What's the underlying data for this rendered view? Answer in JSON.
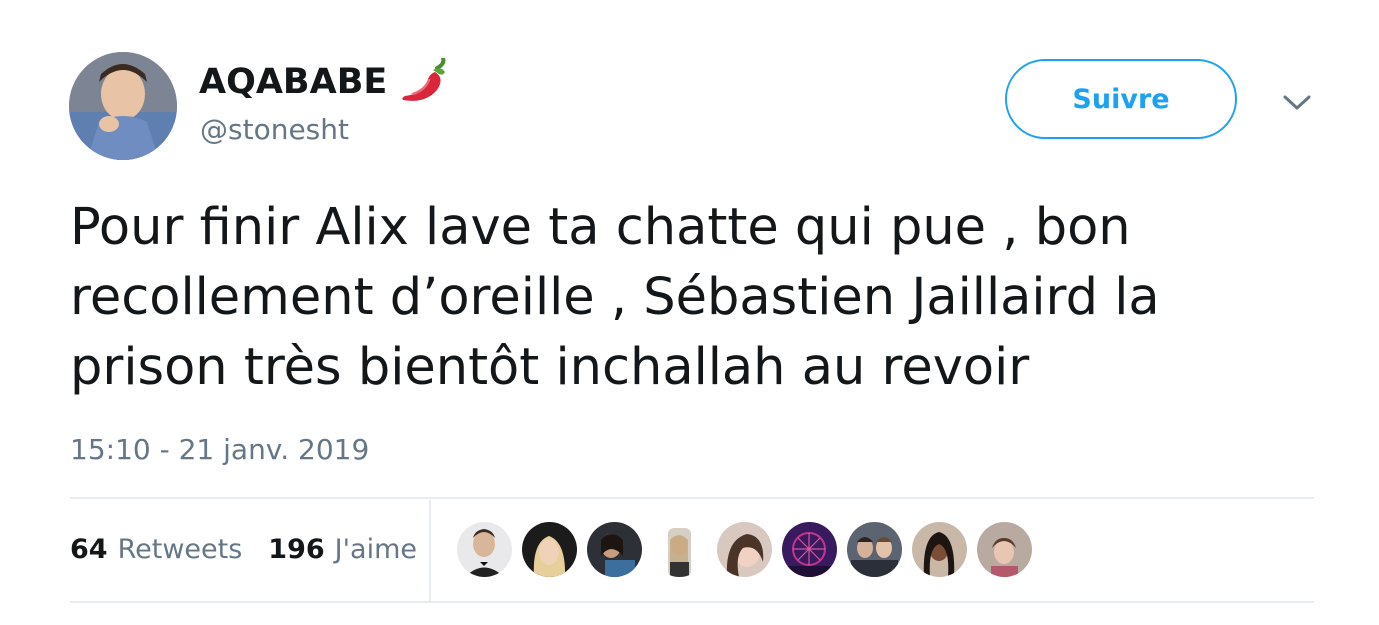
{
  "user": {
    "display_name": "AQABABE",
    "name_emoji": "chili-pepper-icon",
    "handle": "@stonesht",
    "avatar": "user-avatar-photo"
  },
  "follow_button": {
    "label": "Suivre"
  },
  "menu": {
    "icon": "chevron-down-icon"
  },
  "tweet": {
    "lines": [
      "Pour finir Alix lave ta chatte qui pue , bon",
      "recollement d’oreille , Sébastien Jaillaird la",
      "prison très bientôt inchallah au revoir"
    ],
    "timestamp": "15:10 - 21 janv. 2019"
  },
  "stats": {
    "retweets_count": "64",
    "retweets_label": "Retweets",
    "likes_count": "196",
    "likes_label": "J'aime"
  },
  "colors": {
    "accent": "#1da1f2",
    "text": "#14171a",
    "secondary": "#657786",
    "divider": "#e6ecf0"
  }
}
